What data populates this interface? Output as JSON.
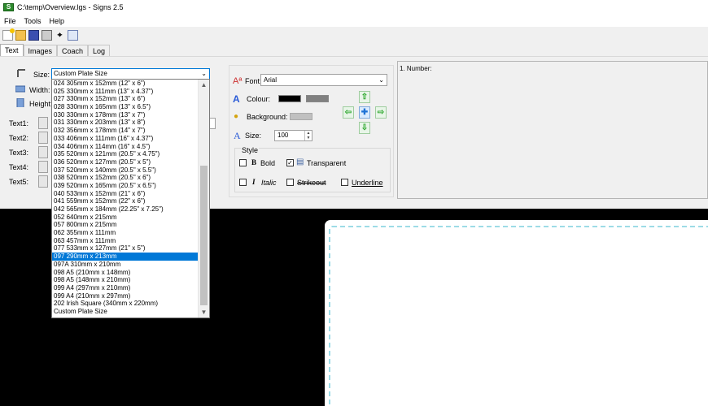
{
  "window": {
    "title": "C:\\temp\\Overview.lgs - Signs 2.5",
    "app_icon_text": "S"
  },
  "menu": [
    "File",
    "Tools",
    "Help"
  ],
  "tabs": [
    "Text",
    "Images",
    "Coach",
    "Log"
  ],
  "size_panel": {
    "size_label": "Size:",
    "size_value": "Custom Plate Size",
    "width_label": "Width:",
    "height_label": "Height:",
    "text_labels": [
      "Text1:",
      "Text2:",
      "Text3:",
      "Text4:",
      "Text5:"
    ]
  },
  "size_options": [
    "024 305mm x 152mm (12\" x 6\")",
    "025 330mm x 111mm (13\" x 4.37\")",
    "027 330mm x 152mm (13\" x 6\")",
    "028 330mm x 165mm (13\" x 6.5\")",
    "030 330mm x 178mm (13\" x 7\")",
    "031 330mm x 203mm (13\" x 8\")",
    "032 356mm x 178mm (14\" x 7\")",
    "033 406mm x 111mm (16\" x 4.37\")",
    "034 406mm x 114mm (16\" x 4.5\")",
    "035 520mm x 121mm (20.5\" x 4.75\")",
    "036 520mm x 127mm (20.5\" x 5\")",
    "037 520mm x 140mm (20.5\" x 5.5\")",
    "038 520mm x 152mm (20.5\" x 6\")",
    "039 520mm x 165mm (20.5\" x 6.5\")",
    "040 533mm x 152mm (21\" x 6\")",
    "041 559mm x 152mm (22\" x 6\")",
    "042 565mm x 184mm (22.25\" x 7.25\")",
    "052 640mm x 215mm",
    "057 800mm x 215mm",
    "062 355mm x 111mm",
    "063 457mm x 111mm",
    "077 533mm x 127mm (21\" x 5\")",
    "097 290mm x 213mm",
    "097A 310mm x 210mm",
    "098 A5 (210mm x 148mm)",
    "098 A5 (148mm x 210mm)",
    "099 A4 (297mm x 210mm)",
    "099 A4 (210mm x 297mm)",
    "202 Irish Square (340mm x 220mm)",
    "Custom Plate Size"
  ],
  "selected_size_index": 22,
  "font_panel": {
    "font_label": "Font:",
    "font_value": "Arial",
    "colour_label": "Colour:",
    "background_label": "Background:",
    "size_label": "Size:",
    "size_value": "100",
    "style_label": "Style",
    "bold_label": "Bold",
    "transparent_label": "Transparent",
    "italic_label": "Italic",
    "strikeout_label": "Strikeout",
    "underline_label": "Underline",
    "colour_swatch": "#000000",
    "colour_swatch2": "#808080",
    "background_swatch": "#c0c0c0",
    "bold_checked": false,
    "transparent_checked": true,
    "italic_checked": false,
    "strikeout_checked": false,
    "underline_checked": false
  },
  "number_box": {
    "text": "1. Number:"
  },
  "arrows": {
    "up": "⇧",
    "down": "⇩",
    "left": "⇦",
    "right": "⇨",
    "center": "✚"
  }
}
